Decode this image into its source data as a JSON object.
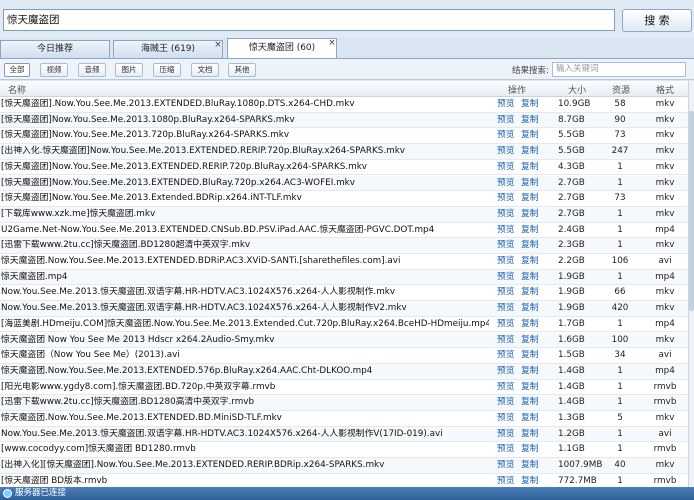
{
  "search": {
    "value": "惊天魔盗团",
    "button_label": "搜 索"
  },
  "tabs": [
    {
      "label": "今日推荐"
    },
    {
      "label": "海贼王 (619)"
    },
    {
      "label": "惊天魔盗团 (60)"
    }
  ],
  "tab_close_glyph": "×",
  "filters": {
    "buttons": [
      "全部",
      "视频",
      "音频",
      "图片",
      "压缩",
      "文档",
      "其他"
    ],
    "search_label": "结果搜索:",
    "search_placeholder": "输入关键词"
  },
  "columns": {
    "name": "名称",
    "action": "操作",
    "size": "大小",
    "sources": "资源",
    "format": "格式"
  },
  "actions": {
    "preview": "预览",
    "copy": "复制"
  },
  "rows": [
    {
      "name": "[惊天魔盗团].Now.You.See.Me.2013.EXTENDED.BluRay.1080p.DTS.x264-CHD.mkv",
      "size": "10.9GB",
      "sources": "58",
      "format": "mkv"
    },
    {
      "name": "[惊天魔盗团]Now.You.See.Me.2013.1080p.BluRay.x264-SPARKS.mkv",
      "size": "8.7GB",
      "sources": "90",
      "format": "mkv"
    },
    {
      "name": "[惊天魔盗团]Now.You.See.Me.2013.720p.BluRay.x264-SPARKS.mkv",
      "size": "5.5GB",
      "sources": "73",
      "format": "mkv"
    },
    {
      "name": "[出神入化.惊天魔盗团]Now.You.See.Me.2013.EXTENDED.RERIP.720p.BluRay.x264-SPARKS.mkv",
      "size": "5.5GB",
      "sources": "247",
      "format": "mkv"
    },
    {
      "name": "[惊天魔盗团]Now.You.See.Me.2013.EXTENDED.RERIP.720p.BluRay.x264-SPARKS.mkv",
      "size": "4.3GB",
      "sources": "1",
      "format": "mkv"
    },
    {
      "name": "[惊天魔盗团]Now.You.See.Me.2013.EXTENDED.BluRay.720p.x264.AC3-WOFEI.mkv",
      "size": "2.7GB",
      "sources": "1",
      "format": "mkv"
    },
    {
      "name": "[惊天魔盗团]Now.You.See.Me.2013.Extended.BDRip.x264.iNT-TLF.mkv",
      "size": "2.7GB",
      "sources": "73",
      "format": "mkv"
    },
    {
      "name": "[下载库www.xzk.me]惊天魔盗团.mkv",
      "size": "2.7GB",
      "sources": "1",
      "format": "mkv"
    },
    {
      "name": "U2Game.Net-Now.You.See.Me.2013.EXTENDED.CNSub.BD.PSV.iPad.AAC.惊天魔盗团-PGVC.DOT.mp4",
      "size": "2.4GB",
      "sources": "1",
      "format": "mp4"
    },
    {
      "name": "[迅雷下载www.2tu.cc]惊天魔盗团.BD1280超清中英双字.mkv",
      "size": "2.3GB",
      "sources": "1",
      "format": "mkv"
    },
    {
      "name": "惊天魔盗团.Now.You.See.Me.2013.EXTENDED.BDRiP.AC3.XViD-SANTi.[sharethefiles.com].avi",
      "size": "2.2GB",
      "sources": "106",
      "format": "avi"
    },
    {
      "name": "惊天魔盗团.mp4",
      "size": "1.9GB",
      "sources": "1",
      "format": "mp4"
    },
    {
      "name": "Now.You.See.Me.2013.惊天魔盗团.双语字幕.HR-HDTV.AC3.1024X576.x264-人人影视制作.mkv",
      "size": "1.9GB",
      "sources": "66",
      "format": "mkv"
    },
    {
      "name": "Now.You.See.Me.2013.惊天魔盗团.双语字幕.HR-HDTV.AC3.1024X576.x264-人人影视制作V2.mkv",
      "size": "1.9GB",
      "sources": "420",
      "format": "mkv"
    },
    {
      "name": "[海蓝美剧.HDmeiju.COM]惊天魔盗团.Now.You.See.Me.2013.Extended.Cut.720p.BluRay.x264.BceHD-HDmeiju.mp4",
      "size": "1.7GB",
      "sources": "1",
      "format": "mp4"
    },
    {
      "name": "惊天魔盗团 Now You See Me 2013 Hdscr x264.2Audio-Smy.mkv",
      "size": "1.6GB",
      "sources": "100",
      "format": "mkv"
    },
    {
      "name": "惊天魔盗团（Now You See Me）(2013).avi",
      "size": "1.5GB",
      "sources": "34",
      "format": "avi"
    },
    {
      "name": "惊天魔盗团.Now.You.See.Me.2013.EXTENDED.576p.BluRay.x264.AAC.Cht-DLKOO.mp4",
      "size": "1.4GB",
      "sources": "1",
      "format": "mp4"
    },
    {
      "name": "[阳光电影www.ygdy8.com].惊天魔盗团.BD.720p.中英双字幕.rmvb",
      "size": "1.4GB",
      "sources": "1",
      "format": "rmvb"
    },
    {
      "name": "[迅雷下载www.2tu.cc]惊天魔盗团.BD1280高清中英双字.rmvb",
      "size": "1.4GB",
      "sources": "1",
      "format": "rmvb"
    },
    {
      "name": "惊天魔盗团.Now.You.See.Me.2013.EXTENDED.BD.MiniSD-TLF.mkv",
      "size": "1.3GB",
      "sources": "5",
      "format": "mkv"
    },
    {
      "name": "Now.You.See.Me.2013.惊天魔盗团.双语字幕.HR-HDTV.AC3.1024X576.x264-人人影视制作V(17ID-019).avi",
      "size": "1.2GB",
      "sources": "1",
      "format": "avi"
    },
    {
      "name": "[www.cocodyy.com]惊天魔盗团 BD1280.rmvb",
      "size": "1.1GB",
      "sources": "1",
      "format": "rmvb"
    },
    {
      "name": "[出神入化][惊天魔盗团].Now.You.See.Me.2013.EXTENDED.RERIP.BDRip.x264-SPARKS.mkv",
      "size": "1007.9MB",
      "sources": "40",
      "format": "mkv"
    },
    {
      "name": "[惊天魔盗团 BD版本.rmvb",
      "size": "772.7MB",
      "sources": "1",
      "format": "rmvb"
    }
  ],
  "status": {
    "text": "服务器已连接"
  }
}
